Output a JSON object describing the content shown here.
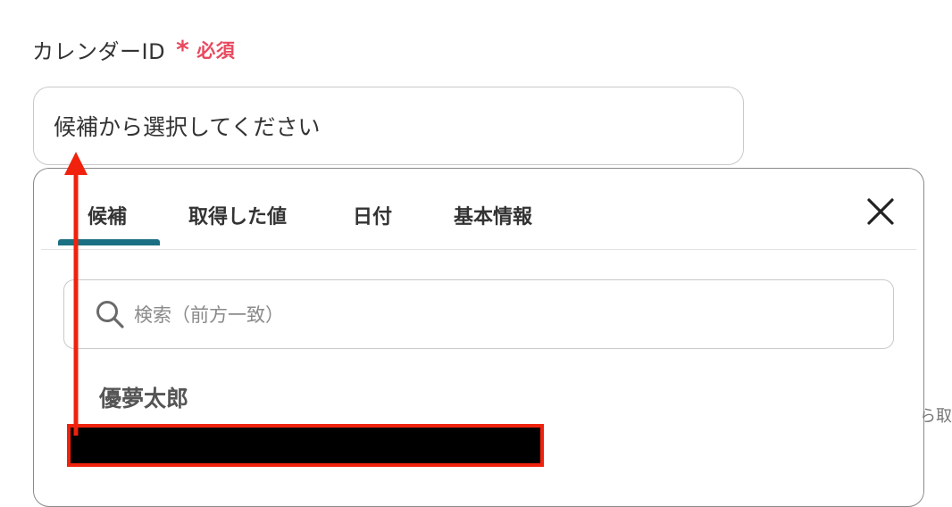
{
  "field": {
    "label": "カレンダーID",
    "required_mark": "*",
    "required_text": "必須"
  },
  "select": {
    "placeholder": "候補から選択してください"
  },
  "tabs": [
    {
      "label": "候補"
    },
    {
      "label": "取得した値"
    },
    {
      "label": "日付"
    },
    {
      "label": "基本情報"
    }
  ],
  "search": {
    "placeholder": "検索（前方一致）"
  },
  "candidates": [
    {
      "name": "優夢太郎"
    }
  ],
  "side_text": "ら取",
  "colors": {
    "required": "#e8495f",
    "tab_active": "#1b6f82",
    "annotation": "#f0220d"
  },
  "icons": {
    "close": "close-icon",
    "search": "search-icon",
    "annotation_arrow": "arrow-up-icon"
  }
}
